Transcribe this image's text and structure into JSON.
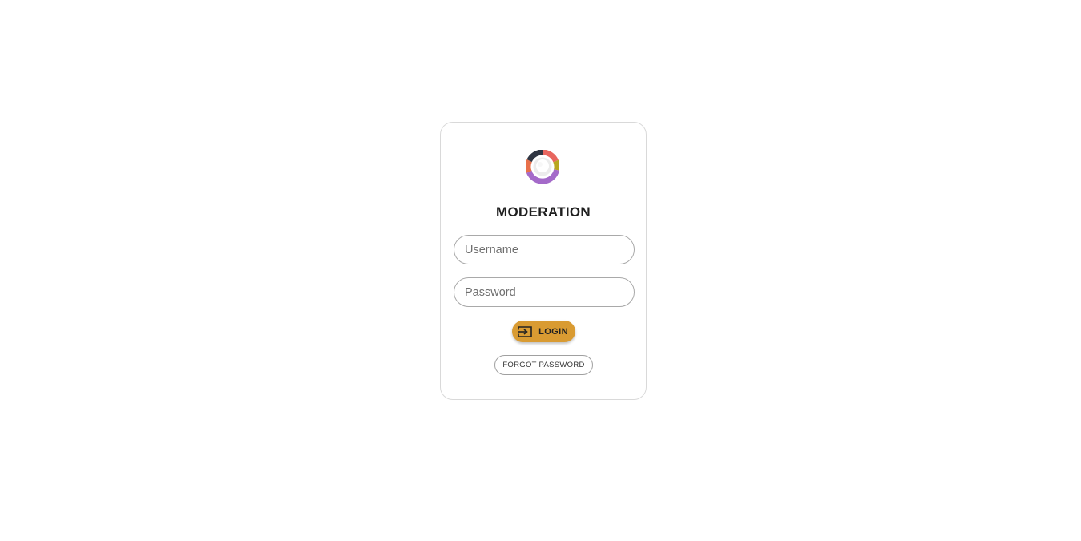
{
  "app": {
    "title": "MODERATION",
    "logo_icon": "moderation-logo-ring"
  },
  "form": {
    "username_placeholder": "Username",
    "password_placeholder": "Password",
    "login_label": "LOGIN",
    "login_icon": "login-enter-icon",
    "forgot_label": "FORGOT PASSWORD"
  },
  "colors": {
    "accent": "#d99b32",
    "border": "#a9a9a9",
    "card_border": "#d9d9d9",
    "title": "#1f1f1f"
  }
}
